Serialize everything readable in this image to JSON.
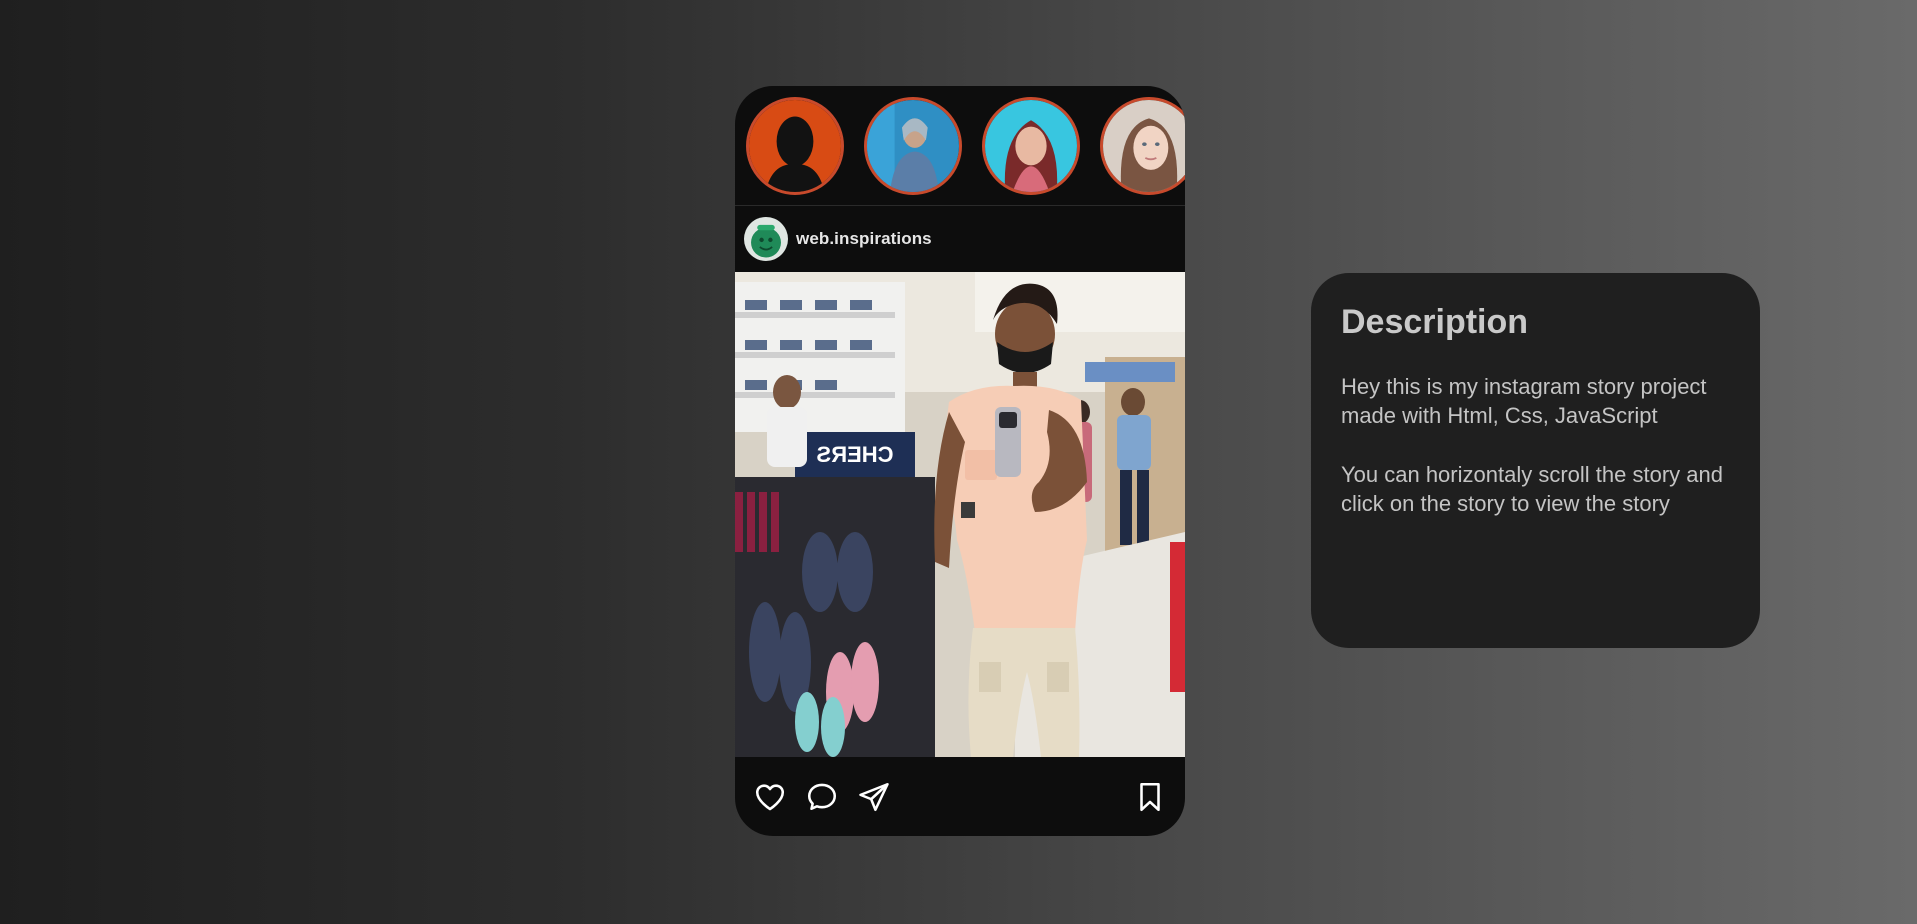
{
  "stories": [
    {
      "name": "story-1"
    },
    {
      "name": "story-2"
    },
    {
      "name": "story-3"
    },
    {
      "name": "story-4"
    }
  ],
  "post": {
    "username": "web.inspirations",
    "actions": {
      "like_icon": "heart-icon",
      "comment_icon": "comment-icon",
      "share_icon": "paper-plane-icon",
      "save_icon": "bookmark-icon"
    }
  },
  "description": {
    "title": "Description",
    "paragraph_1": "Hey this is my instagram story project made with Html, Css, JavaScript",
    "paragraph_2": "You can horizontaly scroll the story and click on the story to view the story"
  },
  "colors": {
    "story_ring": "#c84a2c",
    "card_bg": "#1f1f1f",
    "phone_bg": "#0d0d0d"
  }
}
